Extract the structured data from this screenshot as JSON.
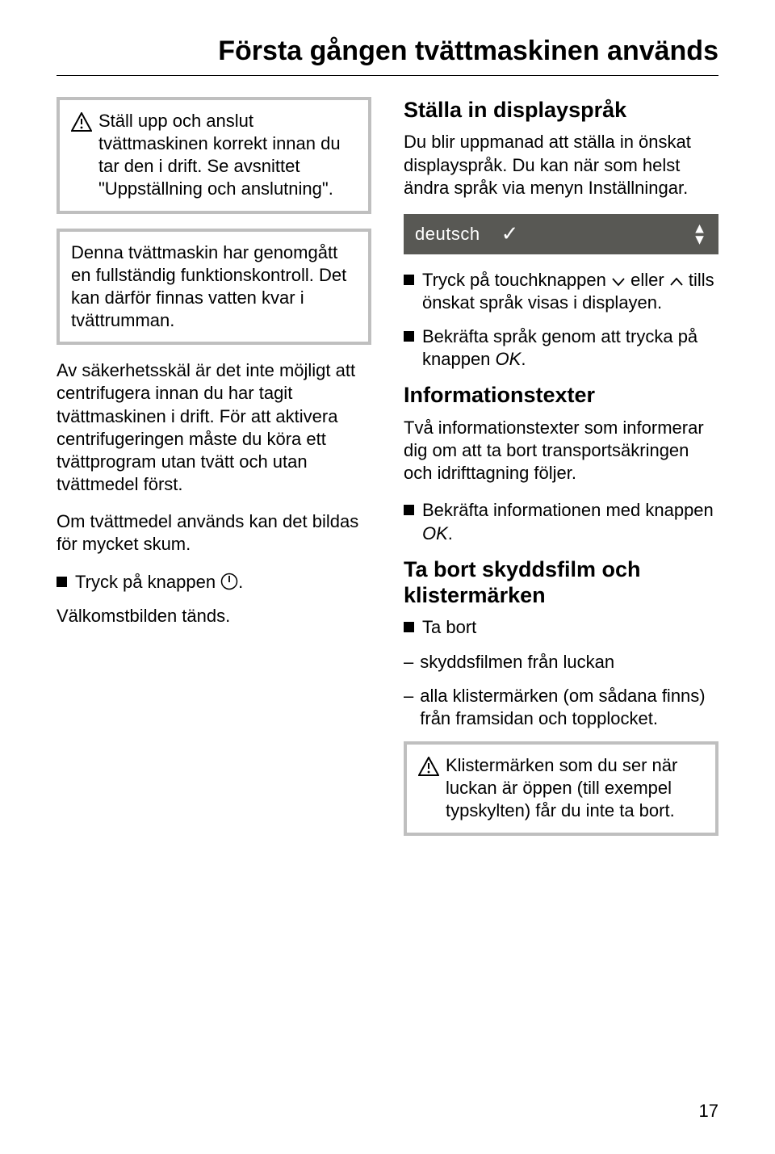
{
  "title": "Första gången tvättmaskinen används",
  "left": {
    "box1": "Ställ upp och anslut tvättmaskinen korrekt innan du tar den i drift. Se avsnittet \"Uppställning och anslutning\".",
    "box2": "Denna tvättmaskin har genomgått en fullständig funktionskontroll. Det kan därför finnas vatten kvar i tvättrumman.",
    "p1": "Av säkerhetsskäl är det inte möjligt att centrifugera innan du har tagit tvättmaskinen i drift. För att aktivera centrifugeringen måste du köra ett tvättprogram utan tvätt och utan tvättmedel först.",
    "p2": "Om tvättmedel används kan det bildas för mycket skum.",
    "bullet1_pre": "Tryck på knappen ",
    "bullet1_post": ".",
    "p3": "Välkomstbilden tänds."
  },
  "right": {
    "h1": "Ställa in displayspråk",
    "p1": "Du blir uppmanad att ställa in önskat displayspråk. Du kan när som helst ändra språk via menyn Inställningar.",
    "display_text": "deutsch",
    "b1_pre": "Tryck på touchknappen ",
    "b1_mid": " eller ",
    "b1_post": " tills önskat språk visas i displayen.",
    "b2_pre": "Bekräfta språk genom att trycka på knappen ",
    "b2_ok": "OK",
    "b2_post": ".",
    "h2": "Informationstexter",
    "p2": "Två informationstexter som informerar dig om att ta bort transportsäkringen och idrifttagning följer.",
    "b3_pre": "Bekräfta informationen med knappen ",
    "b3_ok": "OK",
    "b3_post": ".",
    "h3": "Ta bort skyddsfilm och klistermärken",
    "b4": "Ta bort",
    "d1": "skyddsfilmen från luckan",
    "d2": "alla klistermärken (om sådana finns) från framsidan och topplocket.",
    "box3": "Klistermärken som du ser när luckan är öppen (till exempel typskylten) får du inte ta bort."
  },
  "page_number": "17"
}
